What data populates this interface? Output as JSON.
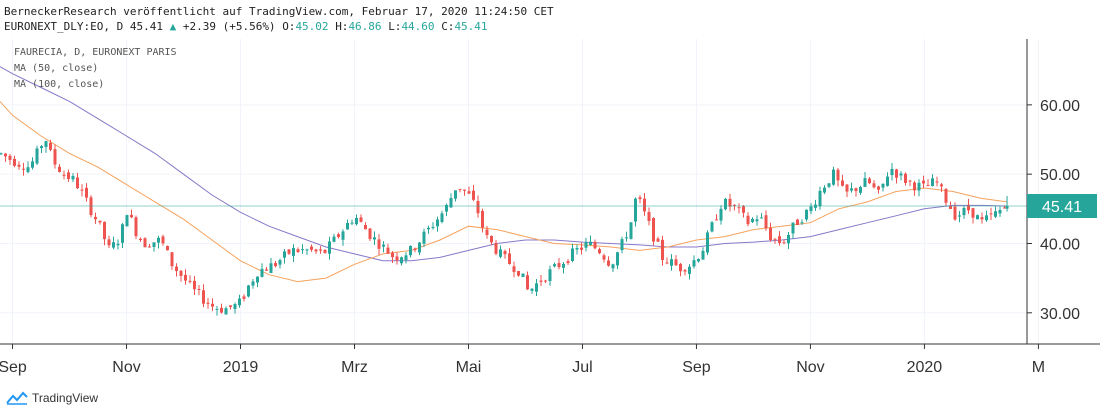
{
  "header": {
    "publisher": "BerneckerResearch veröffentlicht auf TradingView.com, Februar 17, 2020 11:24:50 CET",
    "symbol": "EURONEXT_DLY:EO, D",
    "last": "45.41",
    "change_arrow": "▲",
    "change": "+2.39 (+5.56%)",
    "o_label": "O:",
    "o": "45.02",
    "h_label": "H:",
    "h": "46.86",
    "l_label": "L:",
    "l": "44.60",
    "c_label": "C:",
    "c": "45.41"
  },
  "legend": {
    "title": "FAURECIA, D, EURONEXT PARIS",
    "ma50": "MA (50, close)",
    "ma100": "MA (100, close)"
  },
  "footer": {
    "brand": "TradingView"
  },
  "colors": {
    "up": "#26a69a",
    "down": "#ef5350",
    "ma50": "#f5a25d",
    "ma100": "#8878c8",
    "price_line": "#26a69a",
    "grid": "#f0f3fa",
    "axis": "#333333"
  },
  "chart_data": {
    "type": "candlestick",
    "price_label": "45.41",
    "ylim": [
      25.5,
      69.5
    ],
    "y_ticks": [
      "30.00",
      "40.00",
      "50.00",
      "60.00"
    ],
    "x_ticks": [
      "Sep",
      "Nov",
      "2019",
      "Mrz",
      "Mai",
      "Jul",
      "Sep",
      "Nov",
      "2020",
      "M"
    ],
    "x_tick_positions": [
      0,
      2,
      4,
      6,
      8,
      10,
      12,
      14,
      16,
      18
    ],
    "x_range": [
      -0.22,
      17.8
    ],
    "price_path": [
      [
        -0.22,
        53
      ],
      [
        0.0,
        52
      ],
      [
        0.3,
        51
      ],
      [
        0.5,
        54
      ],
      [
        0.55,
        56
      ],
      [
        0.7,
        52
      ],
      [
        0.9,
        50
      ],
      [
        1.1,
        49
      ],
      [
        1.3,
        46
      ],
      [
        1.5,
        43
      ],
      [
        1.7,
        39
      ],
      [
        1.9,
        41
      ],
      [
        2.0,
        45
      ],
      [
        2.15,
        42
      ],
      [
        2.3,
        40
      ],
      [
        2.6,
        40.5
      ],
      [
        2.8,
        37
      ],
      [
        3.0,
        35
      ],
      [
        3.2,
        33
      ],
      [
        3.5,
        31
      ],
      [
        3.7,
        30.5
      ],
      [
        3.9,
        31
      ],
      [
        4.0,
        31.5
      ],
      [
        4.15,
        34
      ],
      [
        4.3,
        36
      ],
      [
        4.6,
        37
      ],
      [
        4.9,
        39
      ],
      [
        5.2,
        39
      ],
      [
        5.45,
        38.5
      ],
      [
        5.6,
        40
      ],
      [
        5.8,
        42
      ],
      [
        6.0,
        44
      ],
      [
        6.3,
        41
      ],
      [
        6.7,
        38
      ],
      [
        7.0,
        39
      ],
      [
        7.3,
        42
      ],
      [
        7.6,
        45
      ],
      [
        7.8,
        48.5
      ],
      [
        8.0,
        47
      ],
      [
        8.15,
        45
      ],
      [
        8.3,
        41
      ],
      [
        8.6,
        38
      ],
      [
        8.9,
        36
      ],
      [
        9.05,
        33
      ],
      [
        9.3,
        35
      ],
      [
        9.6,
        37
      ],
      [
        9.9,
        39
      ],
      [
        10.1,
        40
      ],
      [
        10.3,
        39
      ],
      [
        10.5,
        37
      ],
      [
        10.7,
        40
      ],
      [
        10.85,
        43
      ],
      [
        10.95,
        47
      ],
      [
        11.2,
        42
      ],
      [
        11.4,
        38
      ],
      [
        11.7,
        36.5
      ],
      [
        11.9,
        37
      ],
      [
        12.1,
        39
      ],
      [
        12.3,
        43
      ],
      [
        12.45,
        46
      ],
      [
        12.7,
        45
      ],
      [
        12.9,
        43
      ],
      [
        13.1,
        44
      ],
      [
        13.3,
        41
      ],
      [
        13.5,
        40
      ],
      [
        13.75,
        43
      ],
      [
        14.0,
        45
      ],
      [
        14.2,
        48
      ],
      [
        14.4,
        50
      ],
      [
        14.6,
        47
      ],
      [
        14.8,
        48
      ],
      [
        15.0,
        49
      ],
      [
        15.2,
        47
      ],
      [
        15.4,
        51
      ],
      [
        15.6,
        49.5
      ],
      [
        15.8,
        48.5
      ],
      [
        16.0,
        48
      ],
      [
        16.2,
        49
      ],
      [
        16.4,
        46
      ],
      [
        16.55,
        44
      ],
      [
        16.8,
        45
      ],
      [
        17.0,
        43
      ],
      [
        17.2,
        44
      ],
      [
        17.45,
        45.41
      ]
    ],
    "ma50": [
      [
        -0.22,
        60.5
      ],
      [
        0.0,
        58.5
      ],
      [
        0.5,
        55.5
      ],
      [
        1.0,
        53
      ],
      [
        1.5,
        51
      ],
      [
        2.0,
        48.5
      ],
      [
        2.5,
        46
      ],
      [
        3.0,
        43.5
      ],
      [
        3.5,
        40.5
      ],
      [
        4.0,
        37.5
      ],
      [
        4.5,
        35.5
      ],
      [
        5.0,
        34.5
      ],
      [
        5.5,
        35
      ],
      [
        6.0,
        37
      ],
      [
        6.5,
        38.5
      ],
      [
        7.0,
        39
      ],
      [
        7.5,
        40.5
      ],
      [
        8.0,
        42.5
      ],
      [
        8.5,
        42
      ],
      [
        9.0,
        41
      ],
      [
        9.5,
        40
      ],
      [
        10.0,
        39.8
      ],
      [
        10.5,
        39.5
      ],
      [
        11.0,
        39
      ],
      [
        11.5,
        39.5
      ],
      [
        12.0,
        40.5
      ],
      [
        12.5,
        41
      ],
      [
        13.0,
        42
      ],
      [
        13.5,
        42.5
      ],
      [
        14.0,
        43
      ],
      [
        14.5,
        45
      ],
      [
        15.0,
        46
      ],
      [
        15.5,
        47.5
      ],
      [
        16.0,
        48
      ],
      [
        16.5,
        47.5
      ],
      [
        17.0,
        46.5
      ],
      [
        17.45,
        46
      ]
    ],
    "ma100": [
      [
        -0.22,
        65.5
      ],
      [
        0.0,
        64.5
      ],
      [
        0.5,
        62.5
      ],
      [
        1.0,
        60.5
      ],
      [
        1.5,
        58
      ],
      [
        2.0,
        55.5
      ],
      [
        2.5,
        53
      ],
      [
        3.0,
        50
      ],
      [
        3.5,
        47
      ],
      [
        4.0,
        44.5
      ],
      [
        4.5,
        42.5
      ],
      [
        5.0,
        41
      ],
      [
        5.5,
        39.5
      ],
      [
        6.0,
        38.5
      ],
      [
        6.5,
        37.5
      ],
      [
        7.0,
        37.5
      ],
      [
        7.5,
        38
      ],
      [
        8.0,
        39
      ],
      [
        8.5,
        40
      ],
      [
        9.0,
        40.5
      ],
      [
        9.5,
        40.5
      ],
      [
        10.0,
        40.2
      ],
      [
        10.5,
        40
      ],
      [
        11.0,
        39.8
      ],
      [
        11.5,
        39.5
      ],
      [
        12.0,
        39.5
      ],
      [
        12.5,
        40
      ],
      [
        13.0,
        40.2
      ],
      [
        13.5,
        40.5
      ],
      [
        14.0,
        41
      ],
      [
        14.5,
        42
      ],
      [
        15.0,
        43
      ],
      [
        15.5,
        44
      ],
      [
        16.0,
        45
      ],
      [
        16.5,
        45.5
      ],
      [
        17.0,
        45.5
      ],
      [
        17.45,
        45.4
      ]
    ]
  }
}
